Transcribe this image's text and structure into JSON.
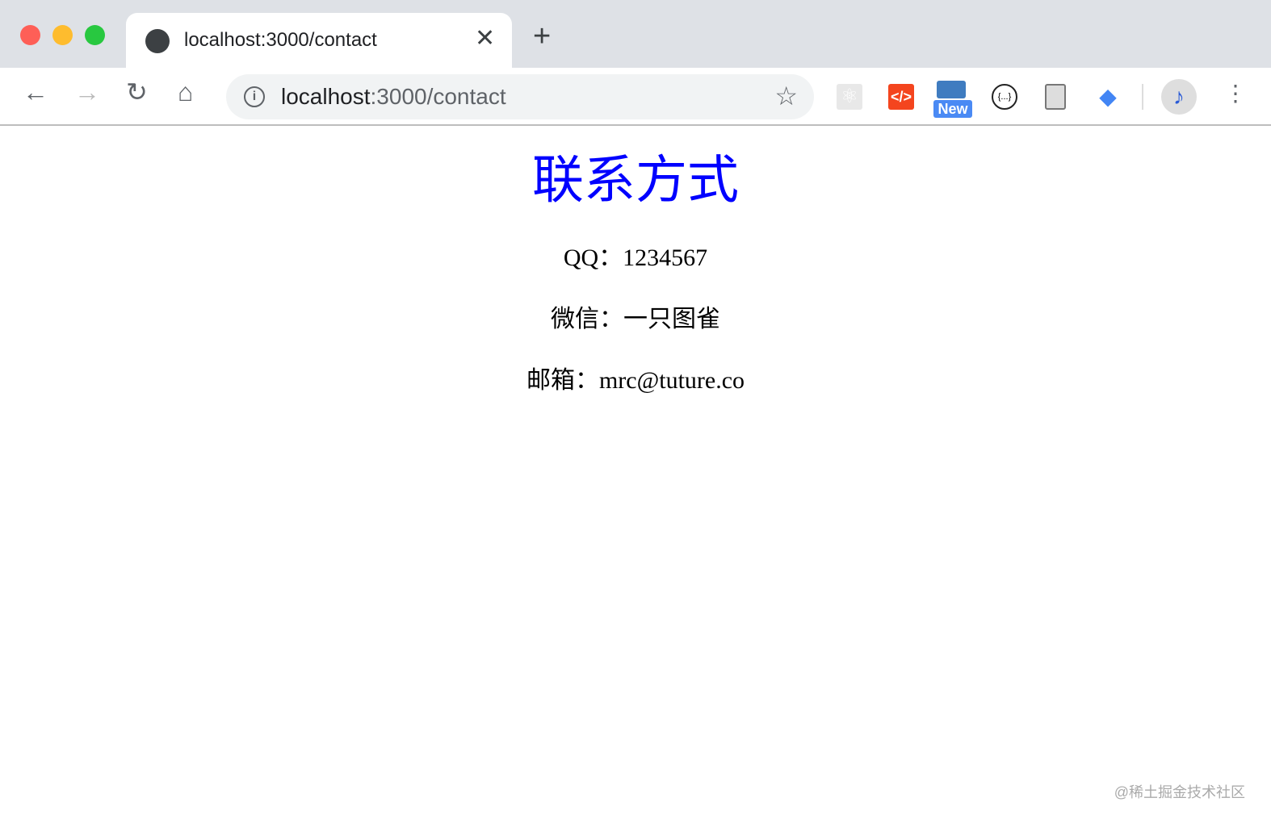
{
  "browser": {
    "tab_title": "localhost:3000/contact",
    "url_host": "localhost",
    "url_rest": ":3000/contact",
    "extensions": [
      "react-devtools-icon",
      "tuture-icon",
      "new-extension-icon",
      "json-viewer-icon",
      "document-icon",
      "scholar-icon"
    ],
    "new_badge": "New"
  },
  "page": {
    "title": "联系方式",
    "title_color": "#0000ff",
    "lines": [
      "QQ：1234567",
      "微信：一只图雀",
      "邮箱：mrc@tuture.co"
    ]
  },
  "watermark": "@稀土掘金技术社区"
}
